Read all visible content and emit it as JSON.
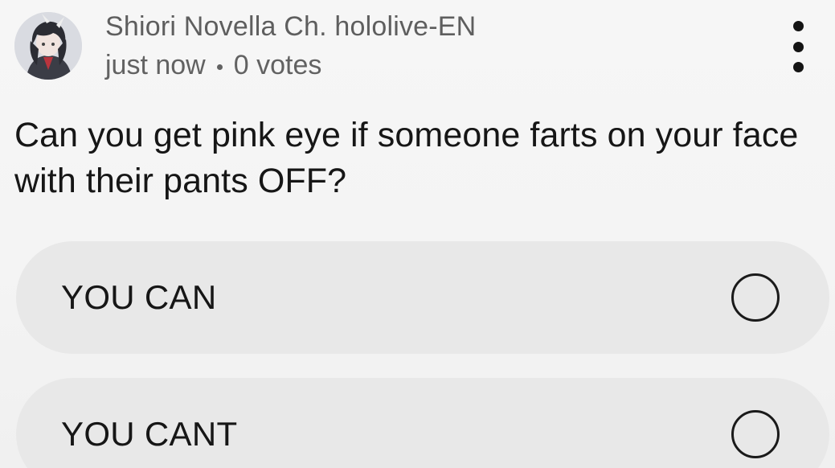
{
  "post": {
    "author_name": "Shiori Novella Ch. hololive-EN",
    "timestamp": "just now",
    "vote_count": "0 votes",
    "question": "Can you get pink eye if someone farts on your face with their pants OFF?",
    "avatar_icon": "profile-avatar",
    "more_icon": "vertical-ellipsis-icon"
  },
  "poll": {
    "options": [
      {
        "label": "YOU CAN",
        "selected": false
      },
      {
        "label": "YOU CANT",
        "selected": false
      }
    ]
  },
  "colors": {
    "background": "#f4f4f4",
    "option_background": "#e8e8e8",
    "secondary_text": "#5e5e5e",
    "primary_text": "#141414"
  }
}
